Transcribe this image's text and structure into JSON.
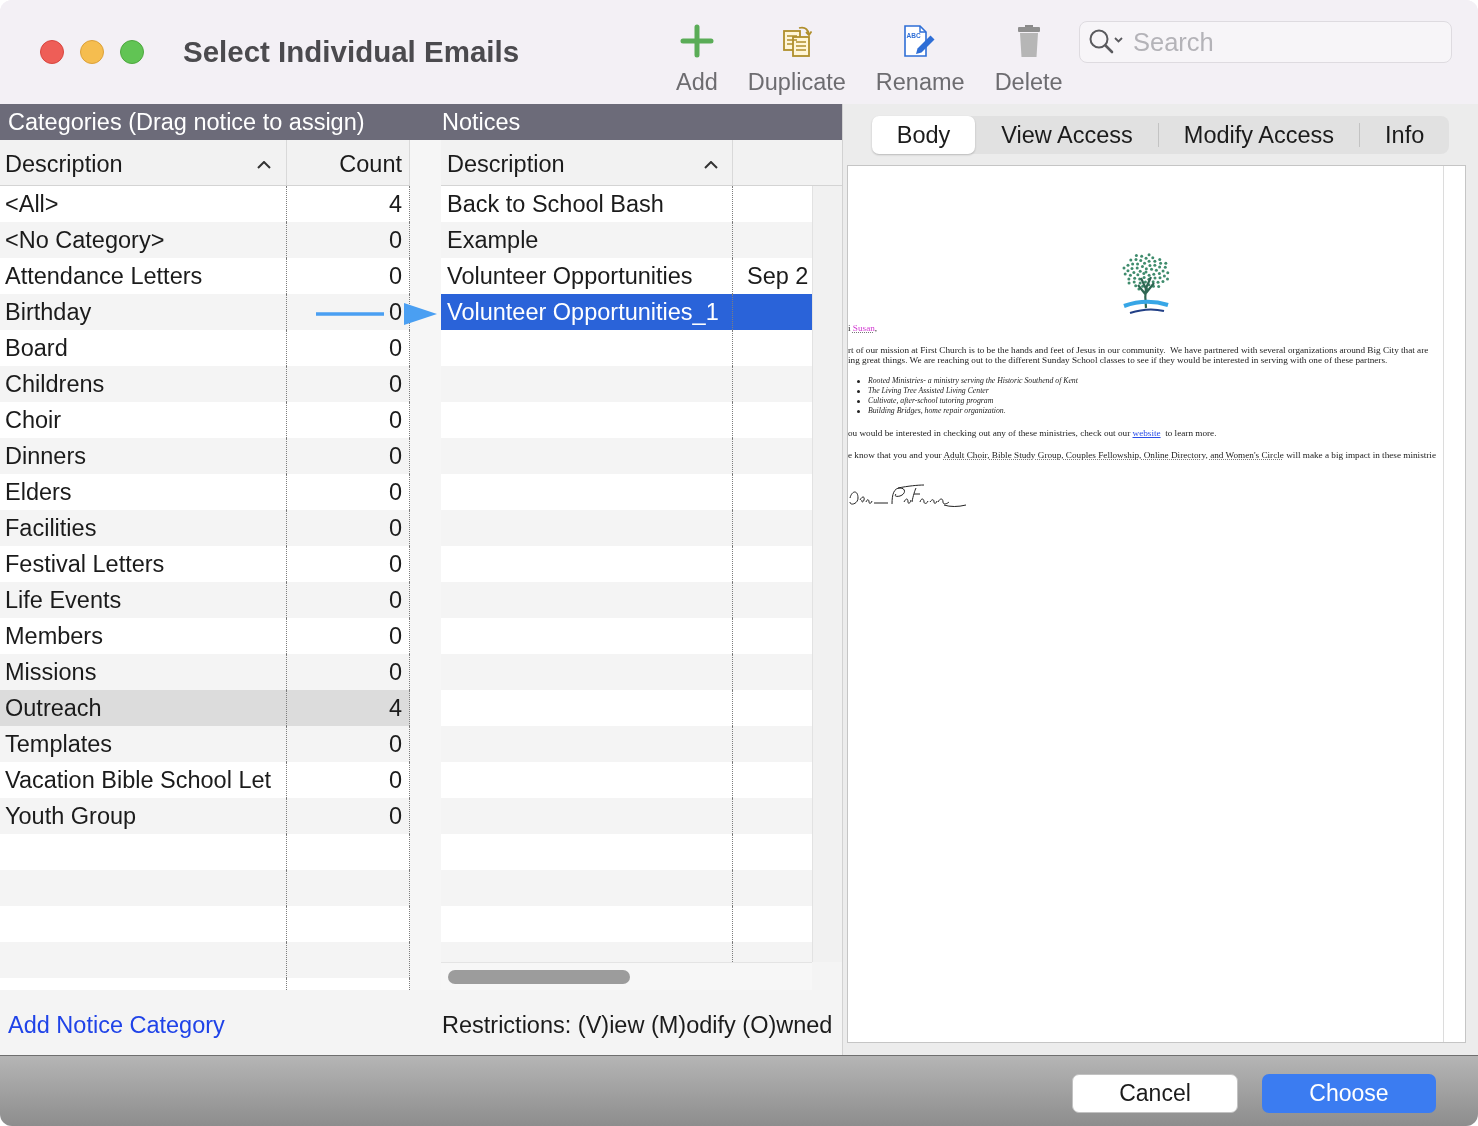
{
  "window": {
    "title": "Select Individual Emails"
  },
  "toolbar": {
    "buttons": [
      {
        "label": "Add",
        "kind": "add"
      },
      {
        "label": "Duplicate",
        "kind": "duplicate"
      },
      {
        "label": "Rename",
        "kind": "rename",
        "icon_text": "ABC"
      },
      {
        "label": "Delete",
        "kind": "delete"
      }
    ],
    "search": {
      "placeholder": "Search"
    }
  },
  "categories": {
    "title": "Categories (Drag notice to assign)",
    "columns": [
      {
        "label": "Description",
        "sorted": true
      },
      {
        "label": "Count",
        "sorted": false
      }
    ],
    "rows": [
      {
        "description": "<All>",
        "count": "4",
        "selected": false
      },
      {
        "description": "<No Category>",
        "count": "0",
        "selected": false
      },
      {
        "description": "Attendance Letters",
        "count": "0",
        "selected": false
      },
      {
        "description": "Birthday",
        "count": "0",
        "selected": false
      },
      {
        "description": "Board",
        "count": "0",
        "selected": false
      },
      {
        "description": "Childrens",
        "count": "0",
        "selected": false
      },
      {
        "description": "Choir",
        "count": "0",
        "selected": false
      },
      {
        "description": "Dinners",
        "count": "0",
        "selected": false
      },
      {
        "description": "Elders",
        "count": "0",
        "selected": false
      },
      {
        "description": "Facilities",
        "count": "0",
        "selected": false
      },
      {
        "description": "Festival Letters",
        "count": "0",
        "selected": false
      },
      {
        "description": "Life Events",
        "count": "0",
        "selected": false
      },
      {
        "description": "Members",
        "count": "0",
        "selected": false
      },
      {
        "description": "Missions",
        "count": "0",
        "selected": false
      },
      {
        "description": "Outreach",
        "count": "4",
        "selected": true
      },
      {
        "description": "Templates",
        "count": "0",
        "selected": false
      },
      {
        "description": "Vacation Bible School Let",
        "count": "0",
        "selected": false
      },
      {
        "description": "Youth Group",
        "count": "0",
        "selected": false
      }
    ],
    "add_link": "Add Notice Category"
  },
  "notices": {
    "title": "Notices",
    "columns": [
      {
        "label": "Description",
        "sorted": true
      }
    ],
    "rows": [
      {
        "description": "Back to School Bash",
        "selected": false
      },
      {
        "description": "Example",
        "selected": false
      },
      {
        "description": "Volunteer Opportunities",
        "column_2": "Sep 2",
        "selected": false
      },
      {
        "description": "Volunteer Opportunities_1",
        "selected": true
      }
    ],
    "restrictions": "Restrictions: (V)iew (M)odify (O)wned"
  },
  "preview": {
    "tabs": [
      {
        "label": "Body",
        "selected": true
      },
      {
        "label": "View Access",
        "selected": false
      },
      {
        "label": "Modify Access",
        "selected": false
      },
      {
        "label": "Info",
        "selected": false
      }
    ],
    "letter": {
      "blocks": [
        {
          "kind": "greeting",
          "lines": [
            [
              {
                "text": "i "
              },
              {
                "text": "Susan",
                "kind": "name_field"
              },
              {
                "text": ","
              }
            ]
          ]
        },
        {
          "kind": "paragraph",
          "lines": [
            [
              {
                "text": "rt of our mission at First Church is to be the hands and feet of Jesus in our community.  We have partnered with several organizations around Big City that are"
              }
            ],
            [
              {
                "text": "ing great things. We are reaching out to the different Sunday School classes to see if they would be interested in serving with one of these partners."
              }
            ]
          ]
        },
        {
          "kind": "bullets",
          "items": [
            "Rooted Ministries- a ministry serving the Historic Southend of Kent",
            "The Living Tree Assisted Living Center",
            "Cultivate, after-school tutoring program",
            "Building Bridges, home repair organization."
          ]
        },
        {
          "kind": "paragraph",
          "lines": [
            [
              {
                "text": "ou would be interested in checking out any of these ministries, check out our "
              },
              {
                "text": "website",
                "kind": "link"
              },
              {
                "text": "  to learn more."
              }
            ]
          ]
        },
        {
          "kind": "paragraph",
          "lines": [
            [
              {
                "text": "e know that you and your "
              },
              {
                "text": "Adult Choir, Bible Study Group, Couples Fellowship, Online Directory, and Women's Circle",
                "kind": "field"
              },
              {
                "text": " will make a big impact in these ministrie"
              }
            ]
          ]
        }
      ]
    }
  },
  "buttons": [
    {
      "label": "Cancel",
      "kind": "cancel"
    },
    {
      "label": "Choose",
      "kind": "default"
    }
  ]
}
